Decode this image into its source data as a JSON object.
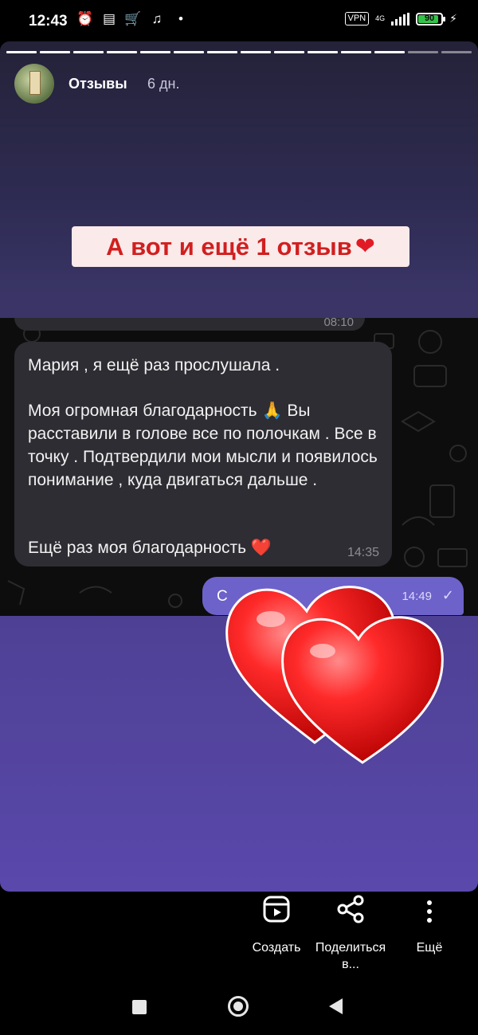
{
  "status_bar": {
    "time": "12:43",
    "icons_left": [
      "alarm-icon",
      "news-icon",
      "cart-icon",
      "music-icon",
      "dot-icon"
    ],
    "vpn": "VPN",
    "network": "4G",
    "battery": "90",
    "battery_level": 0.9,
    "charging": true
  },
  "story": {
    "progress_total": 14,
    "progress_seen": 12,
    "user": "Отзывы",
    "age": "6 дн.",
    "caption": "А вот и ещё 1 отзыв",
    "caption_heart": "❤",
    "chat": {
      "prev_time": "08:10",
      "message_line1": "Мария , я ещё раз прослушала .",
      "message_body": "Моя огромная благодарность 🙏 Вы расставили в голове все по полочкам . Все в точку . Подтвердили мои мысли и появилось понимание , куда двигаться дальше .",
      "message_line3": "Ещё раз моя благодарность ❤️",
      "message_time": "14:35",
      "reply_text": "С",
      "reply_time": "14:49",
      "reply_check": "✓"
    },
    "colors": {
      "caption_bg": "#fbeaea",
      "caption_text": "#d11f1f",
      "bubble": "#2d2d33",
      "reply_bubble": "#6d62c9",
      "heart": "#e11b25"
    }
  },
  "actions": {
    "create": "Создать",
    "share": "Поделиться в...",
    "more": "Ещё"
  },
  "navbar": {
    "buttons": [
      "recent-apps",
      "home",
      "back"
    ]
  }
}
